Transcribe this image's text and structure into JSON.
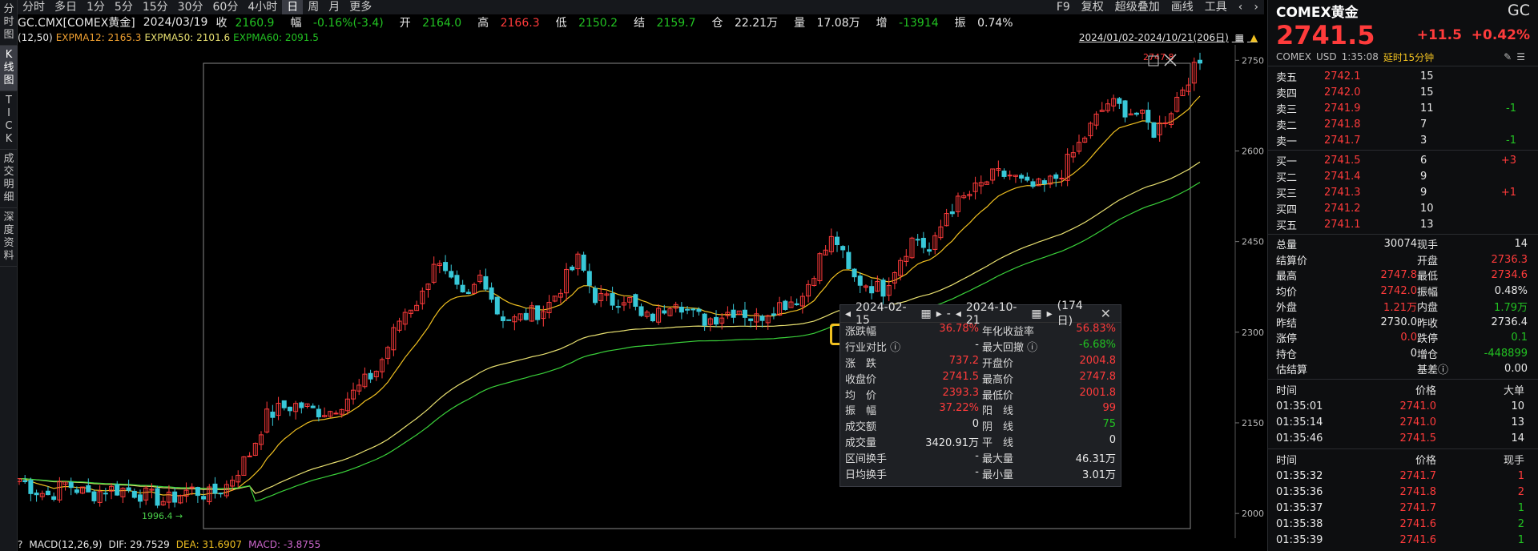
{
  "rail": [
    "分\n时\n图",
    "K\n线\n图",
    "T\nI\nC\nK",
    "成\n交\n明\n细",
    "深\n度\n资\n料"
  ],
  "periods": [
    "分时",
    "多日",
    "1分",
    "5分",
    "15分",
    "30分",
    "60分",
    "4小时",
    "日",
    "周",
    "月",
    "更多"
  ],
  "toolbar": [
    "F9",
    "复权",
    "超级叠加",
    "画线",
    "工具"
  ],
  "info": {
    "code": "GC.CMX[COMEX黄金]",
    "date": "2024/03/19",
    "close_lbl": "收",
    "close": "2160.9",
    "amp_lbl": "幅",
    "amp": "-0.16%(-3.4)",
    "open_lbl": "开",
    "open": "2164.0",
    "high_lbl": "高",
    "high": "2166.3",
    "low_lbl": "低",
    "low": "2150.2",
    "settle_lbl": "结",
    "settle": "2159.7",
    "oi_lbl": "仓",
    "oi": "22.21万",
    "vol_lbl": "量",
    "vol": "17.08万",
    "inc_lbl": "增",
    "inc": "-13914",
    "osc_lbl": "振",
    "osc": "0.74%"
  },
  "ema": {
    "param": "(12,50)",
    "e12": "EXPMA12: 2165.3",
    "e50": "EXPMA50: 2101.6",
    "e60": "EXPMA60: 2091.5",
    "range": "2024/01/02-2024/10/21(206日)"
  },
  "macd": {
    "q": "?",
    "label": "MACD(12,26,9)",
    "dif": "DIF: 29.7529",
    "dea": "DEA: 31.6907",
    "macd": "MACD: -3.8755"
  },
  "axis": {
    "ticks": [
      "2750",
      "2600",
      "2450",
      "2300",
      "2150",
      "2000"
    ],
    "low_mark": "1996.4",
    "high_mark": "2747.8"
  },
  "colors": {
    "up": "#ff3b3b",
    "down": "#22c222",
    "cyan": "#38c8d8",
    "ema12": "#f0c020",
    "ema50": "#e8e070",
    "ema60": "#3ad13a"
  },
  "popup": {
    "start": "2024-02-15",
    "end": "2024-10-21",
    "days": "(174日)",
    "rows": [
      [
        "涨跌幅",
        "36.78%",
        "年化收益率",
        "56.83%"
      ],
      [
        "行业对比 ⓘ",
        "-",
        "最大回撤 ⓘ",
        "-6.68%"
      ],
      [
        "涨　跌",
        "737.2",
        "开盘价",
        "2004.8"
      ],
      [
        "收盘价",
        "2741.5",
        "最高价",
        "2747.8"
      ],
      [
        "均　价",
        "2393.3",
        "最低价",
        "2001.8"
      ],
      [
        "振　幅",
        "37.22%",
        "阳　线",
        "99"
      ],
      [
        "成交额",
        "0",
        "阴　线",
        "75"
      ],
      [
        "成交量",
        "3420.91万",
        "平　线",
        "0"
      ],
      [
        "区间换手",
        "-",
        "最大量",
        "46.31万"
      ],
      [
        "日均换手",
        "-",
        "最小量",
        "3.01万"
      ]
    ]
  },
  "side": {
    "name": "COMEX黄金",
    "code": "GC",
    "price": "2741.5",
    "chg": "+11.5",
    "pct": "+0.42%",
    "meta": [
      "COMEX",
      "USD",
      "1:35:08",
      "延时15分钟"
    ],
    "asks": [
      [
        "卖五",
        "2742.1",
        "15",
        ""
      ],
      [
        "卖四",
        "2742.0",
        "15",
        ""
      ],
      [
        "卖三",
        "2741.9",
        "11",
        "-1"
      ],
      [
        "卖二",
        "2741.8",
        "7",
        ""
      ],
      [
        "卖一",
        "2741.7",
        "3",
        "-1"
      ]
    ],
    "bids": [
      [
        "买一",
        "2741.5",
        "6",
        "+3"
      ],
      [
        "买二",
        "2741.4",
        "9",
        ""
      ],
      [
        "买三",
        "2741.3",
        "9",
        "+1"
      ],
      [
        "买四",
        "2741.2",
        "10",
        ""
      ],
      [
        "买五",
        "2741.1",
        "13",
        ""
      ]
    ],
    "stats": [
      [
        "总量",
        "30074",
        "现手",
        "14"
      ],
      [
        "结算价",
        "",
        "开盘",
        "2736.3"
      ],
      [
        "最高",
        "2747.8",
        "最低",
        "2734.6"
      ],
      [
        "均价",
        "2742.0",
        "振幅",
        "0.48%"
      ],
      [
        "外盘",
        "1.21万",
        "内盘",
        "1.79万"
      ],
      [
        "昨结",
        "2730.0",
        "昨收",
        "2736.4"
      ],
      [
        "涨停",
        "0.0",
        "跌停",
        "0.1"
      ],
      [
        "持仓",
        "0",
        "增仓",
        "-448899"
      ],
      [
        "估结算",
        "",
        "基差ⓘ",
        "0.00"
      ]
    ],
    "big_hdr": [
      "时间",
      "价格",
      "大单"
    ],
    "big": [
      [
        "01:35:01",
        "2741.0",
        "10"
      ],
      [
        "01:35:14",
        "2741.0",
        "13"
      ],
      [
        "01:35:46",
        "2741.5",
        "14"
      ]
    ],
    "tick_hdr": [
      "时间",
      "价格",
      "现手"
    ],
    "ticks": [
      [
        "01:35:32",
        "2741.7",
        "1"
      ],
      [
        "01:35:36",
        "2741.8",
        "2"
      ],
      [
        "01:35:37",
        "2741.7",
        "1"
      ],
      [
        "01:35:38",
        "2741.6",
        "2"
      ],
      [
        "01:35:39",
        "2741.6",
        "1"
      ]
    ]
  }
}
